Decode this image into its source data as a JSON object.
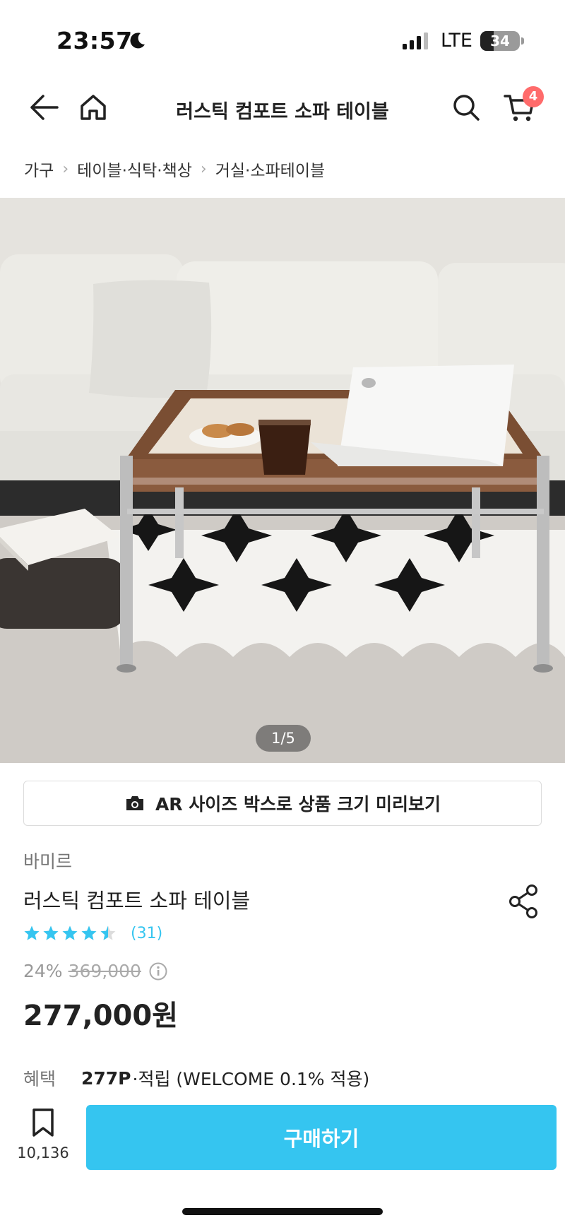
{
  "status_bar": {
    "time": "23:57",
    "network": "LTE",
    "battery": "34",
    "battery_level_percent": 34
  },
  "header": {
    "title": "러스틱 컴포트 소파 테이블",
    "cart_badge": "4"
  },
  "breadcrumb": [
    "가구",
    "테이블·식탁·책상",
    "거실·소파테이블"
  ],
  "image": {
    "counter": "1/5"
  },
  "ar_button": {
    "label": "AR 사이즈 박스로 상품 크기 미리보기"
  },
  "product": {
    "brand": "바미르",
    "name": "러스틱 컴포트 소파 테이블",
    "rating_value": 4.5,
    "rating_count": "(31)",
    "discount": "24%",
    "original_price": "369,000",
    "sale_price": "277,000원"
  },
  "benefit": {
    "label": "혜택",
    "points": "277P",
    "text": "·적립 (WELCOME 0.1% 적용)"
  },
  "bottom_bar": {
    "bookmark_count": "10,136",
    "buy_label": "구매하기"
  },
  "colors": {
    "accent": "#35c5f0",
    "badge": "#ff6b6b",
    "star": "#35c5f0"
  }
}
